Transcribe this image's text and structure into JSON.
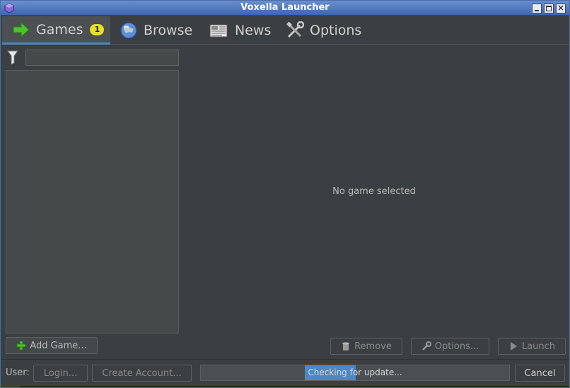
{
  "window": {
    "title": "Voxella Launcher"
  },
  "tabs": [
    {
      "label": "Games",
      "badge": "1",
      "icon": "arrow-right-icon",
      "active": true
    },
    {
      "label": "Browse",
      "icon": "globe-icon",
      "active": false
    },
    {
      "label": "News",
      "icon": "newspaper-icon",
      "active": false
    },
    {
      "label": "Options",
      "icon": "tools-icon",
      "active": false
    }
  ],
  "filter": {
    "value": "",
    "icon": "funnel-icon"
  },
  "main": {
    "empty_text": "No game selected"
  },
  "buttons": {
    "add_game": "Add Game...",
    "remove": "Remove",
    "options": "Options...",
    "launch": "Launch",
    "login": "Login...",
    "create_account": "Create Account...",
    "cancel": "Cancel"
  },
  "footer": {
    "user_label": "User:"
  },
  "progress": {
    "text": "Checking for update..."
  },
  "colors": {
    "accent": "#4a88c7",
    "badge": "#e8e020",
    "background": "#3c3f41"
  }
}
